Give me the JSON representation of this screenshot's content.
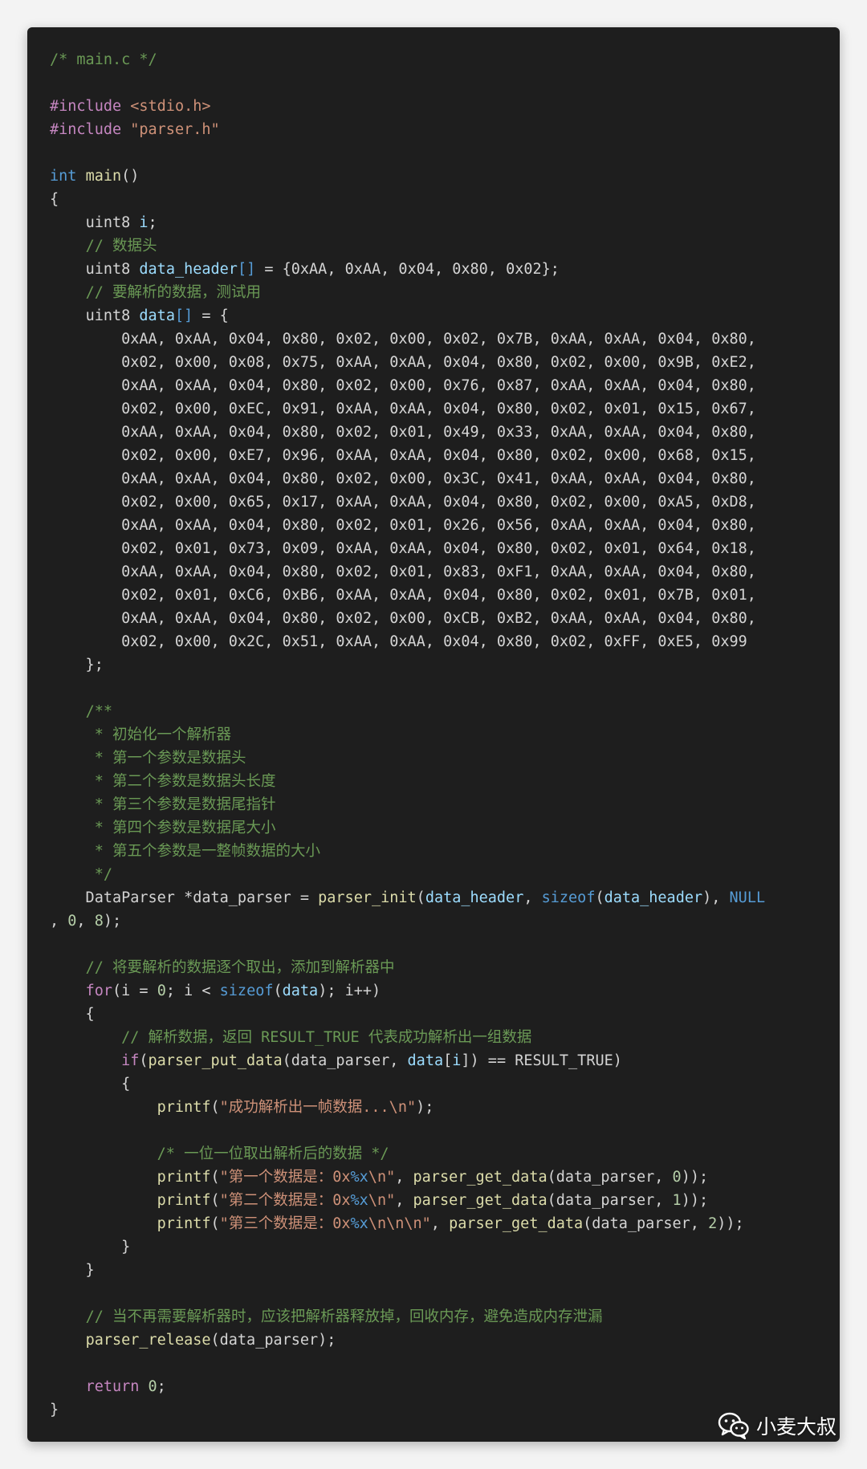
{
  "editor": {
    "lines": [
      [
        {
          "c": "comment",
          "t": "/* main.c */"
        }
      ],
      [],
      [
        {
          "c": "control",
          "t": "#include"
        },
        {
          "c": "plain",
          "t": " "
        },
        {
          "c": "string",
          "t": "<stdio.h>"
        }
      ],
      [
        {
          "c": "control",
          "t": "#include"
        },
        {
          "c": "plain",
          "t": " "
        },
        {
          "c": "string",
          "t": "\"parser.h\""
        }
      ],
      [],
      [
        {
          "c": "keyword",
          "t": "int"
        },
        {
          "c": "plain",
          "t": " "
        },
        {
          "c": "function",
          "t": "main"
        },
        {
          "c": "plain",
          "t": "()"
        }
      ],
      [
        {
          "c": "plain",
          "t": "{"
        }
      ],
      [
        {
          "c": "plain",
          "t": "    "
        },
        {
          "c": "type",
          "t": "uint8"
        },
        {
          "c": "plain",
          "t": " "
        },
        {
          "c": "variable",
          "t": "i"
        },
        {
          "c": "plain",
          "t": ";"
        }
      ],
      [
        {
          "c": "plain",
          "t": "    "
        },
        {
          "c": "comment",
          "t": "// 数据头"
        }
      ],
      [
        {
          "c": "plain",
          "t": "    "
        },
        {
          "c": "type",
          "t": "uint8"
        },
        {
          "c": "plain",
          "t": " "
        },
        {
          "c": "variable",
          "t": "data_header"
        },
        {
          "c": "keyword",
          "t": "[]"
        },
        {
          "c": "plain",
          "t": " = {0xAA, 0xAA, 0x04, 0x80, 0x02};"
        }
      ],
      [
        {
          "c": "plain",
          "t": "    "
        },
        {
          "c": "comment",
          "t": "// 要解析的数据，测试用"
        }
      ],
      [
        {
          "c": "plain",
          "t": "    "
        },
        {
          "c": "type",
          "t": "uint8"
        },
        {
          "c": "plain",
          "t": " "
        },
        {
          "c": "variable",
          "t": "data"
        },
        {
          "c": "keyword",
          "t": "[]"
        },
        {
          "c": "plain",
          "t": " = {"
        }
      ],
      [
        {
          "c": "hex",
          "t": "        0xAA, 0xAA, 0x04, 0x80, 0x02, 0x00, 0x02, 0x7B, 0xAA, 0xAA, 0x04, 0x80,"
        }
      ],
      [
        {
          "c": "hex",
          "t": "        0x02, 0x00, 0x08, 0x75, 0xAA, 0xAA, 0x04, 0x80, 0x02, 0x00, 0x9B, 0xE2,"
        }
      ],
      [
        {
          "c": "hex",
          "t": "        0xAA, 0xAA, 0x04, 0x80, 0x02, 0x00, 0x76, 0x87, 0xAA, 0xAA, 0x04, 0x80,"
        }
      ],
      [
        {
          "c": "hex",
          "t": "        0x02, 0x00, 0xEC, 0x91, 0xAA, 0xAA, 0x04, 0x80, 0x02, 0x01, 0x15, 0x67,"
        }
      ],
      [
        {
          "c": "hex",
          "t": "        0xAA, 0xAA, 0x04, 0x80, 0x02, 0x01, 0x49, 0x33, 0xAA, 0xAA, 0x04, 0x80,"
        }
      ],
      [
        {
          "c": "hex",
          "t": "        0x02, 0x00, 0xE7, 0x96, 0xAA, 0xAA, 0x04, 0x80, 0x02, 0x00, 0x68, 0x15,"
        }
      ],
      [
        {
          "c": "hex",
          "t": "        0xAA, 0xAA, 0x04, 0x80, 0x02, 0x00, 0x3C, 0x41, 0xAA, 0xAA, 0x04, 0x80,"
        }
      ],
      [
        {
          "c": "hex",
          "t": "        0x02, 0x00, 0x65, 0x17, 0xAA, 0xAA, 0x04, 0x80, 0x02, 0x00, 0xA5, 0xD8,"
        }
      ],
      [
        {
          "c": "hex",
          "t": "        0xAA, 0xAA, 0x04, 0x80, 0x02, 0x01, 0x26, 0x56, 0xAA, 0xAA, 0x04, 0x80,"
        }
      ],
      [
        {
          "c": "hex",
          "t": "        0x02, 0x01, 0x73, 0x09, 0xAA, 0xAA, 0x04, 0x80, 0x02, 0x01, 0x64, 0x18,"
        }
      ],
      [
        {
          "c": "hex",
          "t": "        0xAA, 0xAA, 0x04, 0x80, 0x02, 0x01, 0x83, 0xF1, 0xAA, 0xAA, 0x04, 0x80,"
        }
      ],
      [
        {
          "c": "hex",
          "t": "        0x02, 0x01, 0xC6, 0xB6, 0xAA, 0xAA, 0x04, 0x80, 0x02, 0x01, 0x7B, 0x01,"
        }
      ],
      [
        {
          "c": "hex",
          "t": "        0xAA, 0xAA, 0x04, 0x80, 0x02, 0x00, 0xCB, 0xB2, 0xAA, 0xAA, 0x04, 0x80,"
        }
      ],
      [
        {
          "c": "hex",
          "t": "        0x02, 0x00, 0x2C, 0x51, 0xAA, 0xAA, 0x04, 0x80, 0x02, 0xFF, 0xE5, 0x99"
        }
      ],
      [
        {
          "c": "plain",
          "t": "    };"
        }
      ],
      [],
      [
        {
          "c": "plain",
          "t": "    "
        },
        {
          "c": "comment",
          "t": "/**"
        }
      ],
      [
        {
          "c": "plain",
          "t": "    "
        },
        {
          "c": "comment",
          "t": " * 初始化一个解析器"
        }
      ],
      [
        {
          "c": "plain",
          "t": "    "
        },
        {
          "c": "comment",
          "t": " * 第一个参数是数据头"
        }
      ],
      [
        {
          "c": "plain",
          "t": "    "
        },
        {
          "c": "comment",
          "t": " * 第二个参数是数据头长度"
        }
      ],
      [
        {
          "c": "plain",
          "t": "    "
        },
        {
          "c": "comment",
          "t": " * 第三个参数是数据尾指针"
        }
      ],
      [
        {
          "c": "plain",
          "t": "    "
        },
        {
          "c": "comment",
          "t": " * 第四个参数是数据尾大小"
        }
      ],
      [
        {
          "c": "plain",
          "t": "    "
        },
        {
          "c": "comment",
          "t": " * 第五个参数是一整帧数据的大小"
        }
      ],
      [
        {
          "c": "plain",
          "t": "    "
        },
        {
          "c": "comment",
          "t": " */"
        }
      ],
      [
        {
          "c": "plain",
          "t": "    DataParser *data_parser = "
        },
        {
          "c": "function",
          "t": "parser_init"
        },
        {
          "c": "plain",
          "t": "("
        },
        {
          "c": "variable",
          "t": "data_header"
        },
        {
          "c": "plain",
          "t": ", "
        },
        {
          "c": "keyword",
          "t": "sizeof"
        },
        {
          "c": "plain",
          "t": "("
        },
        {
          "c": "variable",
          "t": "data_header"
        },
        {
          "c": "plain",
          "t": "), "
        },
        {
          "c": "keyword",
          "t": "NULL"
        }
      ],
      [
        {
          "c": "plain",
          "t": ", "
        },
        {
          "c": "number",
          "t": "0"
        },
        {
          "c": "plain",
          "t": ", "
        },
        {
          "c": "number",
          "t": "8"
        },
        {
          "c": "plain",
          "t": ");"
        }
      ],
      [],
      [
        {
          "c": "plain",
          "t": "    "
        },
        {
          "c": "comment",
          "t": "// 将要解析的数据逐个取出，添加到解析器中"
        }
      ],
      [
        {
          "c": "plain",
          "t": "    "
        },
        {
          "c": "control",
          "t": "for"
        },
        {
          "c": "plain",
          "t": "(i = "
        },
        {
          "c": "number",
          "t": "0"
        },
        {
          "c": "plain",
          "t": "; i < "
        },
        {
          "c": "keyword",
          "t": "sizeof"
        },
        {
          "c": "plain",
          "t": "("
        },
        {
          "c": "variable",
          "t": "data"
        },
        {
          "c": "plain",
          "t": "); i++)"
        }
      ],
      [
        {
          "c": "plain",
          "t": "    {"
        }
      ],
      [
        {
          "c": "plain",
          "t": "        "
        },
        {
          "c": "comment",
          "t": "// 解析数据，返回 RESULT_TRUE 代表成功解析出一组数据"
        }
      ],
      [
        {
          "c": "plain",
          "t": "        "
        },
        {
          "c": "control",
          "t": "if"
        },
        {
          "c": "plain",
          "t": "("
        },
        {
          "c": "function",
          "t": "parser_put_data"
        },
        {
          "c": "plain",
          "t": "(data_parser, "
        },
        {
          "c": "variable",
          "t": "data"
        },
        {
          "c": "plain",
          "t": "["
        },
        {
          "c": "variable",
          "t": "i"
        },
        {
          "c": "plain",
          "t": "]) == RESULT_TRUE)"
        }
      ],
      [
        {
          "c": "plain",
          "t": "        {"
        }
      ],
      [
        {
          "c": "plain",
          "t": "            "
        },
        {
          "c": "function",
          "t": "printf"
        },
        {
          "c": "plain",
          "t": "("
        },
        {
          "c": "string",
          "t": "\"成功解析出一帧数据...\\n\""
        },
        {
          "c": "plain",
          "t": ");"
        }
      ],
      [],
      [
        {
          "c": "plain",
          "t": "            "
        },
        {
          "c": "comment",
          "t": "/* 一位一位取出解析后的数据 */"
        }
      ],
      [
        {
          "c": "plain",
          "t": "            "
        },
        {
          "c": "function",
          "t": "printf"
        },
        {
          "c": "plain",
          "t": "("
        },
        {
          "c": "string",
          "t": "\"第一个数据是：0x"
        },
        {
          "c": "keyword",
          "t": "%x"
        },
        {
          "c": "string",
          "t": "\\n\""
        },
        {
          "c": "plain",
          "t": ", "
        },
        {
          "c": "function",
          "t": "parser_get_data"
        },
        {
          "c": "plain",
          "t": "(data_parser, "
        },
        {
          "c": "number",
          "t": "0"
        },
        {
          "c": "plain",
          "t": "));"
        }
      ],
      [
        {
          "c": "plain",
          "t": "            "
        },
        {
          "c": "function",
          "t": "printf"
        },
        {
          "c": "plain",
          "t": "("
        },
        {
          "c": "string",
          "t": "\"第二个数据是：0x"
        },
        {
          "c": "keyword",
          "t": "%x"
        },
        {
          "c": "string",
          "t": "\\n\""
        },
        {
          "c": "plain",
          "t": ", "
        },
        {
          "c": "function",
          "t": "parser_get_data"
        },
        {
          "c": "plain",
          "t": "(data_parser, "
        },
        {
          "c": "number",
          "t": "1"
        },
        {
          "c": "plain",
          "t": "));"
        }
      ],
      [
        {
          "c": "plain",
          "t": "            "
        },
        {
          "c": "function",
          "t": "printf"
        },
        {
          "c": "plain",
          "t": "("
        },
        {
          "c": "string",
          "t": "\"第三个数据是：0x"
        },
        {
          "c": "keyword",
          "t": "%x"
        },
        {
          "c": "string",
          "t": "\\n\\n\\n\""
        },
        {
          "c": "plain",
          "t": ", "
        },
        {
          "c": "function",
          "t": "parser_get_data"
        },
        {
          "c": "plain",
          "t": "(data_parser, "
        },
        {
          "c": "number",
          "t": "2"
        },
        {
          "c": "plain",
          "t": "));"
        }
      ],
      [
        {
          "c": "plain",
          "t": "        }"
        }
      ],
      [
        {
          "c": "plain",
          "t": "    }"
        }
      ],
      [],
      [
        {
          "c": "plain",
          "t": "    "
        },
        {
          "c": "comment",
          "t": "// 当不再需要解析器时，应该把解析器释放掉，回收内存，避免造成内存泄漏"
        }
      ],
      [
        {
          "c": "plain",
          "t": "    "
        },
        {
          "c": "function",
          "t": "parser_release"
        },
        {
          "c": "plain",
          "t": "(data_parser);"
        }
      ],
      [],
      [
        {
          "c": "plain",
          "t": "    "
        },
        {
          "c": "control",
          "t": "return"
        },
        {
          "c": "plain",
          "t": " "
        },
        {
          "c": "number",
          "t": "0"
        },
        {
          "c": "plain",
          "t": ";"
        }
      ],
      [
        {
          "c": "plain",
          "t": "}"
        }
      ]
    ]
  },
  "watermark": {
    "icon": "wechat-icon",
    "text": "小麦大叔"
  },
  "colors": {
    "background": "#1e1e1e",
    "comment": "#6a9955",
    "string": "#ce9178",
    "keyword": "#569cd6",
    "control": "#c586c0",
    "function": "#dcdcaa",
    "variable": "#9cdcfe",
    "number": "#b5cea8"
  }
}
